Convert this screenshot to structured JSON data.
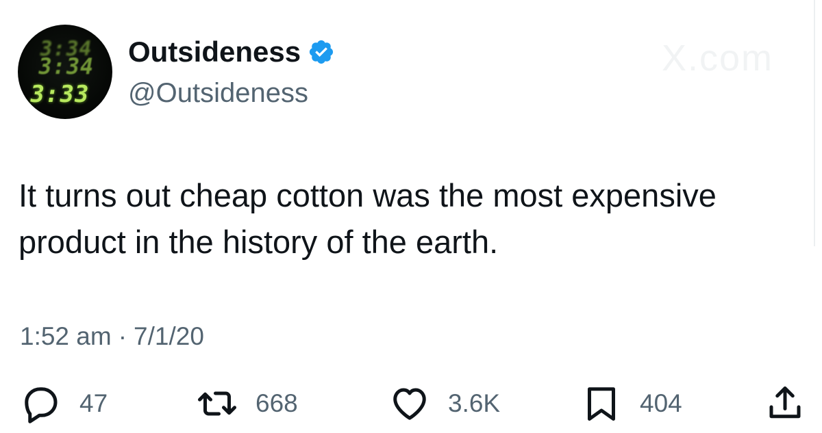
{
  "author": {
    "display_name": "Outsideness",
    "handle": "@Outsideness",
    "verified": true,
    "verified_color": "#1d9bf0",
    "avatar_text": [
      "3:34",
      "3:34",
      "3:33"
    ]
  },
  "watermark": "X.com",
  "tweet": {
    "text": "It turns out cheap cotton was the most expensive\nproduct in the history of the earth."
  },
  "meta": {
    "time": "1:52 am",
    "separator": "·",
    "date": "7/1/20"
  },
  "actions": {
    "reply": {
      "icon": "reply-icon",
      "count": "47"
    },
    "retweet": {
      "icon": "retweet-icon",
      "count": "668"
    },
    "like": {
      "icon": "heart-icon",
      "count": "3.6K"
    },
    "bookmark": {
      "icon": "bookmark-icon",
      "count": "404"
    },
    "share": {
      "icon": "share-icon"
    }
  },
  "colors": {
    "text": "#0f1419",
    "secondary": "#536471",
    "accent": "#1d9bf0"
  }
}
